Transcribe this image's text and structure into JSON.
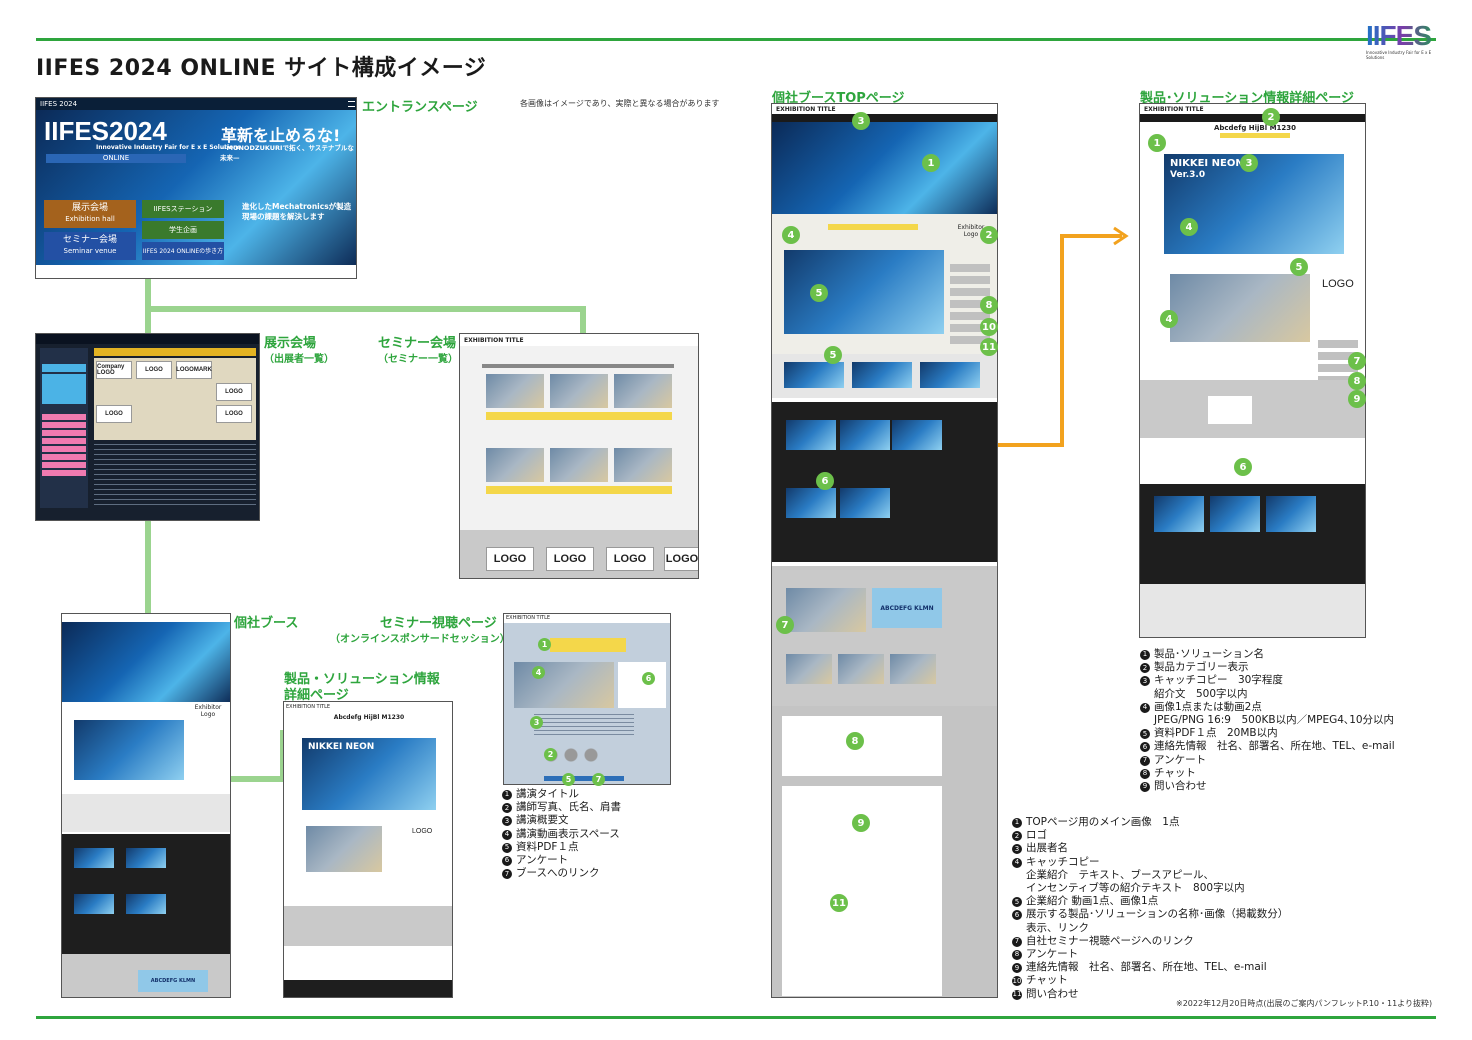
{
  "header": {
    "title": "IIFES 2024 ONLINE サイト構成イメージ",
    "logo_text": "IIFES",
    "logo_sub": "Innovative Industry Fair for E x E Solutions"
  },
  "disclaimer": "各画像はイメージであり、実際と異なる場合があります",
  "footnote": "※2022年12月20日時点(出展のご案内パンフレットP.10・11より抜粋)",
  "labels": {
    "entrance": "エントランスページ",
    "exhibition_hall": "展示会場",
    "exhibition_hall_sub": "（出展者一覧）",
    "seminar_hall": "セミナー会場",
    "seminar_hall_sub": "（セミナー一覧）",
    "booth": "個社ブース",
    "seminar_view": "セミナー視聴ページ",
    "seminar_view_sub": "（オンラインスポンサードセッション）",
    "product_detail_line1": "製品・ソリューション情報",
    "product_detail_line2": "詳細ページ",
    "booth_top": "個社ブースTOPページ",
    "product_detail_big": "製品･ソリューション情報詳細ページ"
  },
  "entrance": {
    "brand": "IIFES 2024",
    "logo_big": "IIFES2024",
    "online": "ONLINE",
    "tagline": "Innovative Industry Fair for E x E Solutions",
    "headline": "革新を止めるな!",
    "subheadline": "—MONODZUKURIで拓く、サステナブルな未来—",
    "btn_exhibit": "展示会場",
    "btn_exhibit_en": "Exhibition hall",
    "btn_seminar": "セミナー会場",
    "btn_seminar_en": "Seminar venue",
    "btn_station": "IIFESステーション",
    "btn_academy": "学生企画",
    "btn_guide": "IIFES 2024 ONLINEの歩き方",
    "promo": "進化したMechatronicsが製造現場の課題を解決します"
  },
  "hall_logos": [
    "Company LOGO",
    "LOGO",
    "LOGOMARK",
    "LOGO",
    "LOGO",
    "LOGO"
  ],
  "seminar_logos": [
    "LOGO",
    "LOGO",
    "LOGO",
    "LOGO"
  ],
  "mock": {
    "exhibition_title": "EXHIBITION TITLE",
    "product_name": "Abcdefg HijBl M1230",
    "nikkei": "NIKKEI NEON",
    "version": "Ver.3.0",
    "exhibitor_logo": "Exhibitor Logo",
    "logo": "LOGO",
    "banner": "ABCDEFG KLMN"
  },
  "seminar_legend": [
    {
      "n": "1",
      "text": "講演タイトル"
    },
    {
      "n": "2",
      "text": "講師写真、氏名、肩書"
    },
    {
      "n": "3",
      "text": "講演概要文"
    },
    {
      "n": "4",
      "text": "講演動画表示スペース"
    },
    {
      "n": "5",
      "text": "資料PDF１点"
    },
    {
      "n": "6",
      "text": "アンケート"
    },
    {
      "n": "7",
      "text": "ブースへのリンク"
    }
  ],
  "booth_legend": [
    {
      "n": "1",
      "text": "TOPページ用のメイン画像　1点"
    },
    {
      "n": "2",
      "text": "ロゴ"
    },
    {
      "n": "3",
      "text": "出展者名"
    },
    {
      "n": "4",
      "text": "キャッチコピー",
      "cont": [
        "企業紹介　テキスト、ブースアピール、",
        "インセンティブ等の紹介テキスト　800字以内"
      ]
    },
    {
      "n": "5",
      "text": "企業紹介  動画1点、画像1点"
    },
    {
      "n": "6",
      "text": "展示する製品･ソリューションの名称･画像（掲載数分）",
      "cont": [
        "表示、リンク"
      ]
    },
    {
      "n": "7",
      "text": "自社セミナー視聴ページへのリンク"
    },
    {
      "n": "8",
      "text": "アンケート"
    },
    {
      "n": "9",
      "text": "連絡先情報　社名、部署名、所在地、TEL、e-mail"
    },
    {
      "n": "10",
      "text": "チャット"
    },
    {
      "n": "11",
      "text": "問い合わせ"
    }
  ],
  "product_legend": [
    {
      "n": "1",
      "text": "製品･ソリューション名"
    },
    {
      "n": "2",
      "text": "製品カテゴリー表示"
    },
    {
      "n": "3",
      "text": "キャッチコピー　30字程度",
      "cont": [
        "紹介文　500字以内"
      ]
    },
    {
      "n": "4",
      "text": "画像1点または動画2点",
      "cont": [
        "JPEG/PNG 16:9　500KB以内／MPEG4､10分以内"
      ]
    },
    {
      "n": "5",
      "text": "資料PDF１点　20MB以内"
    },
    {
      "n": "6",
      "text": "連絡先情報　社名、部署名、所在地、TEL、e-mail"
    },
    {
      "n": "7",
      "text": "アンケート"
    },
    {
      "n": "8",
      "text": "チャット"
    },
    {
      "n": "9",
      "text": "問い合わせ"
    }
  ],
  "colors": {
    "accent_green": "#2ea53d",
    "connector": "#9bd48f",
    "arrow": "#f2a21e",
    "badge": "#6cc04a"
  }
}
